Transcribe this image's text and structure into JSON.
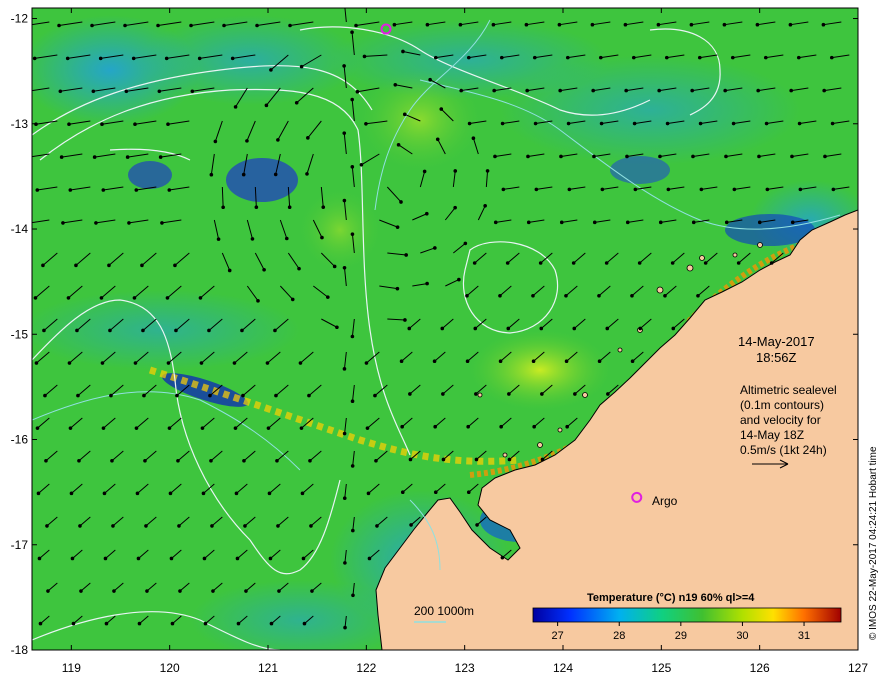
{
  "map": {
    "lon_ticks": [
      "119",
      "120",
      "121",
      "122",
      "123",
      "124",
      "125",
      "126",
      "127"
    ],
    "lat_ticks": [
      "-12",
      "-13",
      "-14",
      "-15",
      "-16",
      "-17",
      "-18"
    ],
    "lon_range": [
      118.6,
      127
    ],
    "lat_range": [
      -18,
      -11.9
    ],
    "date": "14-May-2017",
    "time": "18:56Z",
    "altimetry_lines": [
      "Altimetric sealevel",
      "(0.1m contours)",
      "and velocity for",
      "14-May 18Z",
      "0.5m/s (1kt 24h)"
    ],
    "argo_label": "Argo",
    "argo_floats": [
      {
        "lon": 124.75,
        "lat": -16.55
      },
      {
        "lon": 122.2,
        "lat": -12.1
      }
    ],
    "depth_legend": "200  1000m",
    "credit": "© IMOS 22-May-2017 04:24:21 Hobart time",
    "colors": {
      "land": "#f7c9a0",
      "ocean_base": "#3ec53e",
      "argo_marker": "#e020e0",
      "contour": "#e8f4f4",
      "depth_200": "#90e0e0"
    }
  },
  "colorbar": {
    "title": "Temperature (°C) n19 60% ql>=4",
    "ticks": [
      "27",
      "28",
      "29",
      "30",
      "31"
    ],
    "range": [
      26.6,
      31.6
    ],
    "tick_values": [
      27,
      28,
      29,
      30,
      31
    ]
  }
}
